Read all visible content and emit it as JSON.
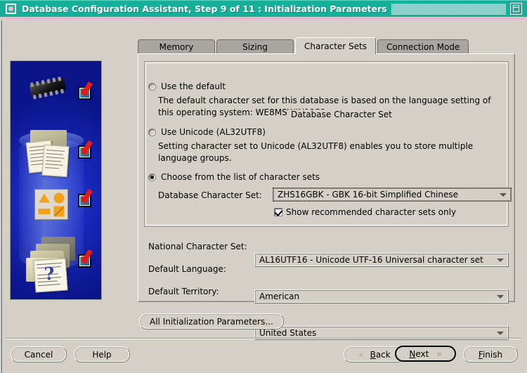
{
  "window": {
    "title": "Database Configuration Assistant, Step 9 of 11 : Initialization Parameters",
    "app_icon": "oracle-circle-icon",
    "restore_button_icon": "restore-window-icon",
    "titlebar_color": "#15b09a"
  },
  "illustration": {
    "alt": "database-wizard-illustration",
    "icons": [
      "memory-chip-icon",
      "documents-icon",
      "shapes-icon",
      "folders-question-icon"
    ],
    "check_marks": 4,
    "check_color": "#e01b1b"
  },
  "tabs": [
    {
      "label": "Memory",
      "active": false
    },
    {
      "label": "Sizing",
      "active": false
    },
    {
      "label": "Character Sets",
      "active": true
    },
    {
      "label": "Connection Mode",
      "active": false
    }
  ],
  "group": {
    "title": "Database Character Set",
    "options": [
      {
        "id": "use-default",
        "label": "Use the default",
        "selected": false,
        "description": "The default character set for this database is based on the language setting of this operating system: WE8MSWIN1252."
      },
      {
        "id": "use-unicode",
        "label": "Use Unicode (AL32UTF8)",
        "selected": false,
        "description": "Setting character set to Unicode (AL32UTF8) enables you to store multiple language groups."
      },
      {
        "id": "choose-from-list",
        "label": "Choose from the list of character sets",
        "selected": true,
        "description": ""
      }
    ],
    "db_charset": {
      "label": "Database Character Set:",
      "value": "ZHS16GBK - GBK 16-bit Simplified Chinese"
    },
    "recommended_checkbox": {
      "label": "Show recommended character sets only",
      "checked": true
    }
  },
  "fields": [
    {
      "label": "National Character Set:",
      "value": "AL16UTF16 - Unicode UTF-16 Universal character set"
    },
    {
      "label": "Default Language:",
      "value": "American"
    },
    {
      "label": "Default Territory:",
      "value": "United States"
    }
  ],
  "all_params_button": "All Initialization Parameters...",
  "footer": {
    "cancel": "Cancel",
    "help": "Help",
    "back": {
      "label": "Back",
      "mnemonic": "B",
      "chevron": "«"
    },
    "next": {
      "label": "Next",
      "mnemonic": "N",
      "chevron": "»"
    },
    "finish": {
      "label": "Finish",
      "mnemonic": "F"
    }
  }
}
